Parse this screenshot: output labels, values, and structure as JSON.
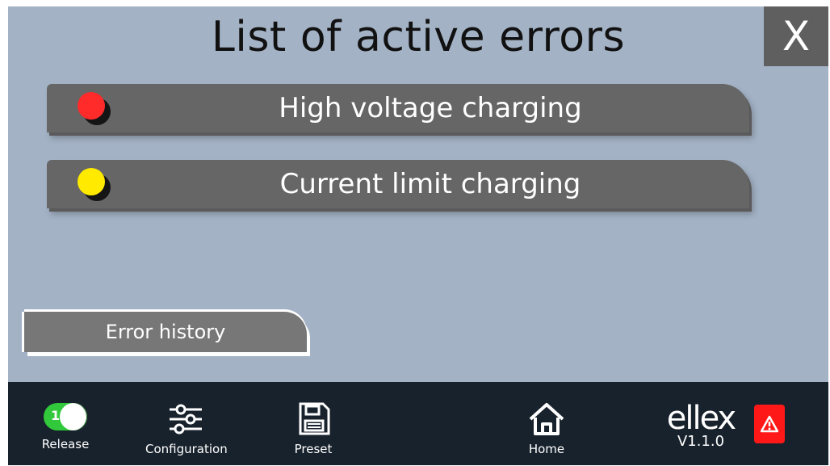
{
  "header": {
    "title": "List of active errors",
    "close_label": "X"
  },
  "errors": [
    {
      "label": "High voltage charging",
      "status_color": "#ff2a2a"
    },
    {
      "label": "Current limit charging",
      "status_color": "#ffea00"
    }
  ],
  "actions": {
    "history_label": "Error history"
  },
  "bottom_bar": {
    "release": {
      "label": "Release",
      "toggle_text": "1",
      "toggle_state": "on"
    },
    "configuration": {
      "label": "Configuration",
      "icon": "sliders-icon"
    },
    "preset": {
      "label": "Preset",
      "icon": "save-icon"
    },
    "home": {
      "label": "Home",
      "icon": "home-icon"
    },
    "brand": {
      "name": "ellex",
      "version": "V1.1.0"
    },
    "alert": {
      "icon": "warning-icon",
      "color": "#ff1818"
    }
  },
  "colors": {
    "background": "#a3b2c5",
    "panel": "#666666",
    "bottom_bar": "#18222c",
    "toggle_on": "#31c93b"
  }
}
